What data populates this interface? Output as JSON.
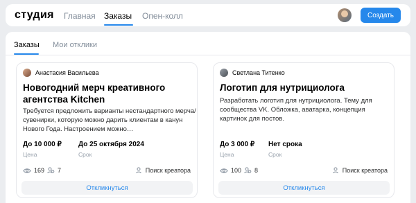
{
  "header": {
    "logo": "студия",
    "nav": [
      {
        "label": "Главная",
        "active": false
      },
      {
        "label": "Заказы",
        "active": true
      },
      {
        "label": "Опен-колл",
        "active": false
      }
    ],
    "create_label": "Создать"
  },
  "tabs": [
    {
      "label": "Заказы",
      "active": true
    },
    {
      "label": "Мои отклики",
      "active": false
    }
  ],
  "cards": [
    {
      "author": "Анастасия Васильева",
      "title": "Новогодний мерч креативного агентства Kitchen",
      "description": "Требуется предложить варианты нестандартного мерча/сувенирки, которую можно дарить клиентам в канун Нового Года. Настроением можно…",
      "price": "До 10 000 ₽",
      "price_label": "Цена",
      "deadline": "До 25 октября 2024",
      "deadline_label": "Срок",
      "views": "169",
      "responses": "7",
      "find_creator": "Поиск креатора",
      "respond_label": "Откликнуться"
    },
    {
      "author": "Светлана Титенко",
      "title": "Логотип для нутрициолога",
      "description": "Разработать логотип для нутрициолога. Тему для сообщества VK. Обложка, аватарка, концепция картинок для постов.",
      "price": "До 3 000 ₽",
      "price_label": "Цена",
      "deadline": "Нет срока",
      "deadline_label": "Срок",
      "views": "100",
      "responses": "8",
      "find_creator": "Поиск креатора",
      "respond_label": "Откликнуться"
    }
  ],
  "colors": {
    "accent": "#2688eb",
    "background": "#ebedf0",
    "muted": "#818c99"
  }
}
